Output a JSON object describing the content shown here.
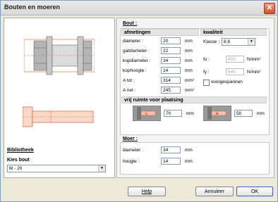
{
  "window": {
    "title": "Bouten en moeren"
  },
  "left": {
    "library_header": "Bibliotheek",
    "kies_bout_label": "Kies bout",
    "kies_bout_value": "M - 20"
  },
  "bout": {
    "header": "Bout :",
    "afmetingen_title": "afmetingen",
    "kwaliteit_title": "kwaliteit",
    "fields": [
      {
        "label": "diameter :",
        "value": "20",
        "unit": "mm"
      },
      {
        "label": "gatdiameter :",
        "value": "22",
        "unit": "mm"
      },
      {
        "label": "kopdiameter :",
        "value": "34",
        "mm": true,
        "unit": "mm"
      },
      {
        "label": "kophoogte :",
        "value": "14",
        "unit": "mm"
      },
      {
        "label": "A tot :",
        "value": "314",
        "unit": "mm²"
      },
      {
        "label": "A net :",
        "value": "245",
        "unit": "mm²"
      }
    ],
    "klasse_label": "Klasse :",
    "klasse_value": "8.8",
    "fu_label": "fu :",
    "fu_value": "800",
    "fu_unit": "N/mm²",
    "fy_label": "fy :",
    "fy_value": "640",
    "fy_unit": "N/mm²",
    "voorgespannen_label": "voorgespannen"
  },
  "vrij": {
    "title": "vrij ruimte voor plaatsing",
    "left_value": "70",
    "left_unit": "mm",
    "right_value": "50",
    "right_unit": "mm",
    "left_sym": "c",
    "right_sym": "e"
  },
  "moer": {
    "header": "Moer :",
    "diameter_label": "diameter :",
    "diameter_value": "34",
    "diameter_unit": "mm",
    "hoogte_label": "hoogte :",
    "hoogte_value": "14",
    "hoogte_unit": "mm"
  },
  "buttons": {
    "help": "Help",
    "annuleer": "Annuleer",
    "ok": "OK"
  },
  "colors": {
    "accent": "#e06020",
    "bolt_gray": "#a8a8a8"
  }
}
